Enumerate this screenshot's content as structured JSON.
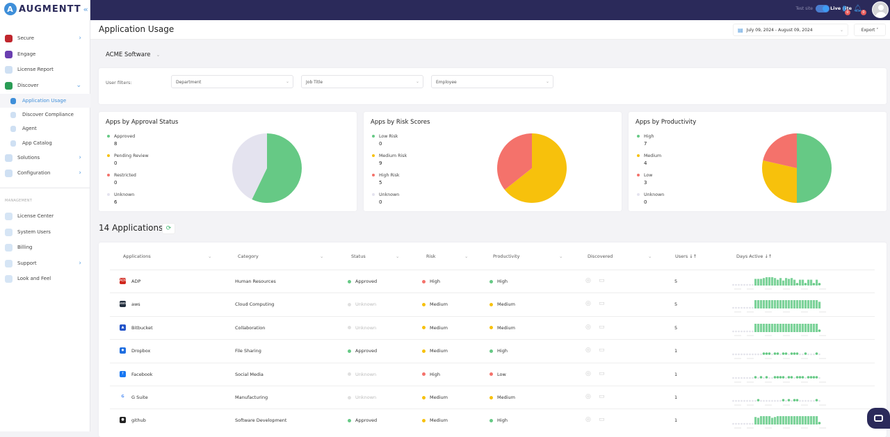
{
  "brand": "AUGMENTT",
  "colors": {
    "navy": "#2b2a5a",
    "accent": "#3f8fd9",
    "green": "#66c985",
    "yellow": "#f7c10c",
    "red": "#f4726b",
    "gray": "#e4e3ef"
  },
  "sidebar": {
    "items": [
      {
        "label": "Secure",
        "icon": "shield-icon",
        "chev": "›"
      },
      {
        "label": "Engage",
        "icon": "network-icon"
      },
      {
        "label": "License Report",
        "icon": "document-icon"
      },
      {
        "label": "Discover",
        "icon": "magnifier-icon",
        "chev": "⌄"
      },
      {
        "label": "Application Usage",
        "icon": "pie-chart-icon",
        "sub": true,
        "active": true
      },
      {
        "label": "Discover Compliance",
        "icon": "clipboard-icon",
        "sub": true
      },
      {
        "label": "Agent",
        "icon": "server-icon",
        "sub": true
      },
      {
        "label": "App Catalog",
        "icon": "window-icon",
        "sub": true
      },
      {
        "label": "Solutions",
        "icon": "lightbulb-icon",
        "chev": "›"
      },
      {
        "label": "Configuration",
        "icon": "gear-icon",
        "chev": "›"
      }
    ],
    "section": "MANAGEMENT",
    "mgmt": [
      {
        "label": "License Center",
        "icon": "badge-icon"
      },
      {
        "label": "System Users",
        "icon": "users-icon"
      },
      {
        "label": "Billing",
        "icon": "coins-icon"
      },
      {
        "label": "Support",
        "icon": "lifebuoy-icon",
        "chev": "›"
      },
      {
        "label": "Look and Feel",
        "icon": "window-icon"
      }
    ]
  },
  "topbar": {
    "test_site": "Test site",
    "live_site": "Live site",
    "live_on": true,
    "tasks_badge": "0",
    "notif_badge": "0"
  },
  "header": {
    "title": "Application Usage",
    "date_range": "July 09, 2024 - August 09, 2024",
    "export": "Export"
  },
  "company": "ACME Software",
  "filters": {
    "label": "User filters:",
    "department": "Department",
    "job_title": "Job Title",
    "employee": "Employee"
  },
  "charts": [
    {
      "title": "Apps by Approval Status",
      "items": [
        {
          "label": "Approved",
          "value": 8,
          "color": "#66c985"
        },
        {
          "label": "Pending Review",
          "value": 0,
          "color": "#f7c10c"
        },
        {
          "label": "Restricted",
          "value": 0,
          "color": "#f4726b"
        },
        {
          "label": "Unknown",
          "value": 6,
          "color": "#e4e3ef"
        }
      ]
    },
    {
      "title": "Apps by Risk Scores",
      "items": [
        {
          "label": "Low Risk",
          "value": 0,
          "color": "#66c985"
        },
        {
          "label": "Medium Risk",
          "value": 9,
          "color": "#f7c10c"
        },
        {
          "label": "High Risk",
          "value": 5,
          "color": "#f4726b"
        },
        {
          "label": "Unknown",
          "value": 0,
          "color": "#e4e3ef"
        }
      ]
    },
    {
      "title": "Apps by Productivity",
      "items": [
        {
          "label": "High",
          "value": 7,
          "color": "#66c985"
        },
        {
          "label": "Medium",
          "value": 4,
          "color": "#f7c10c"
        },
        {
          "label": "Low",
          "value": 3,
          "color": "#f4726b"
        },
        {
          "label": "Unknown",
          "value": 0,
          "color": "#e4e3ef"
        }
      ]
    }
  ],
  "apps_title": "14 Applications",
  "table": {
    "headers": [
      "Applications",
      "Category",
      "Status",
      "Risk",
      "Productivity",
      "Discovered",
      "Users ↓↑",
      "Days Active ↓↑"
    ],
    "rows": [
      {
        "name": "ADP",
        "icon_color": "#d0271d",
        "icon_text": "ADP",
        "category": "Human Resources",
        "status": "Approved",
        "risk": "High",
        "productivity": "High",
        "users": "5",
        "activity": [
          0,
          0,
          0,
          0,
          0,
          0,
          0,
          0,
          0.8,
          0.8,
          0.8,
          0.9,
          1,
          1,
          1,
          0.9,
          0.7,
          0.9,
          0.6,
          0.9,
          0.8,
          0.9,
          0.7,
          0.1,
          0.7,
          0.7,
          0.1,
          0.7,
          0.7,
          0.1,
          0.7,
          0.2
        ]
      },
      {
        "name": "aws",
        "icon_color": "#232f3e",
        "icon_text": "aws",
        "category": "Cloud Computing",
        "status": "Unknown",
        "risk": "Medium",
        "productivity": "Medium",
        "users": "5",
        "activity": [
          0,
          0,
          0,
          0,
          0,
          0,
          0,
          0,
          1,
          1,
          1,
          1,
          1,
          1,
          1,
          1,
          1,
          1,
          1,
          1,
          1,
          1,
          1,
          1,
          1,
          1,
          1,
          1,
          1,
          1,
          1,
          0.8
        ]
      },
      {
        "name": "Bitbucket",
        "icon_color": "#2354c9",
        "icon_text": "▲",
        "category": "Collaboration",
        "status": "Unknown",
        "risk": "Medium",
        "productivity": "Medium",
        "users": "5",
        "activity": [
          0,
          0,
          0,
          0,
          0,
          0,
          0,
          0,
          1,
          1,
          1,
          1,
          1,
          1,
          1,
          1,
          1,
          1,
          1,
          1,
          1,
          1,
          1,
          1,
          1,
          1,
          1,
          1,
          1,
          1,
          1,
          0.2
        ]
      },
      {
        "name": "Dropbox",
        "icon_color": "#1f6ee0",
        "icon_text": "◆",
        "category": "File Sharing",
        "status": "Approved",
        "risk": "Medium",
        "productivity": "High",
        "users": "1",
        "activity": [
          0,
          0,
          0,
          0,
          0,
          0,
          0,
          0,
          0,
          0,
          0,
          0.2,
          0.2,
          0.2,
          0,
          0.2,
          0.2,
          0,
          0.2,
          0.2,
          0,
          0.2,
          0.2,
          0.2,
          0,
          0,
          0.2,
          0,
          0,
          0,
          0.2,
          0
        ]
      },
      {
        "name": "Facebook",
        "icon_color": "#1877f2",
        "icon_text": "f",
        "category": "Social Media",
        "status": "Unknown",
        "risk": "High",
        "productivity": "Low",
        "users": "1",
        "activity": [
          0,
          0,
          0,
          0,
          0,
          0,
          0,
          0,
          0.2,
          0,
          0.2,
          0,
          0.2,
          0,
          0,
          0.2,
          0.2,
          0.2,
          0.2,
          0,
          0.2,
          0.2,
          0,
          0.2,
          0.2,
          0.2,
          0,
          0.2,
          0.2,
          0.2,
          0.2,
          0
        ]
      },
      {
        "name": "G Suite",
        "icon_color": "#ffffff",
        "icon_text": "G",
        "category": "Manufacturing",
        "status": "Unknown",
        "risk": "Medium",
        "productivity": "Medium",
        "users": "1",
        "activity": [
          0,
          0,
          0,
          0,
          0,
          0,
          0,
          0,
          0,
          0.2,
          0,
          0,
          0,
          0,
          0,
          0,
          0,
          0,
          0.2,
          0,
          0.2,
          0,
          0.2,
          0.2,
          0,
          0,
          0,
          0,
          0,
          0,
          0.2,
          0
        ]
      },
      {
        "name": "github",
        "icon_color": "#222222",
        "icon_text": "●",
        "category": "Software Development",
        "status": "Approved",
        "risk": "Medium",
        "productivity": "High",
        "users": "1",
        "activity": [
          0,
          0,
          0,
          0,
          0,
          0,
          0,
          0,
          0.9,
          0.8,
          1,
          1,
          1,
          1,
          0.8,
          0.9,
          1,
          1,
          1,
          1,
          1,
          1,
          1,
          1,
          1,
          1,
          1,
          1,
          1,
          1,
          1,
          0.2
        ]
      }
    ]
  }
}
